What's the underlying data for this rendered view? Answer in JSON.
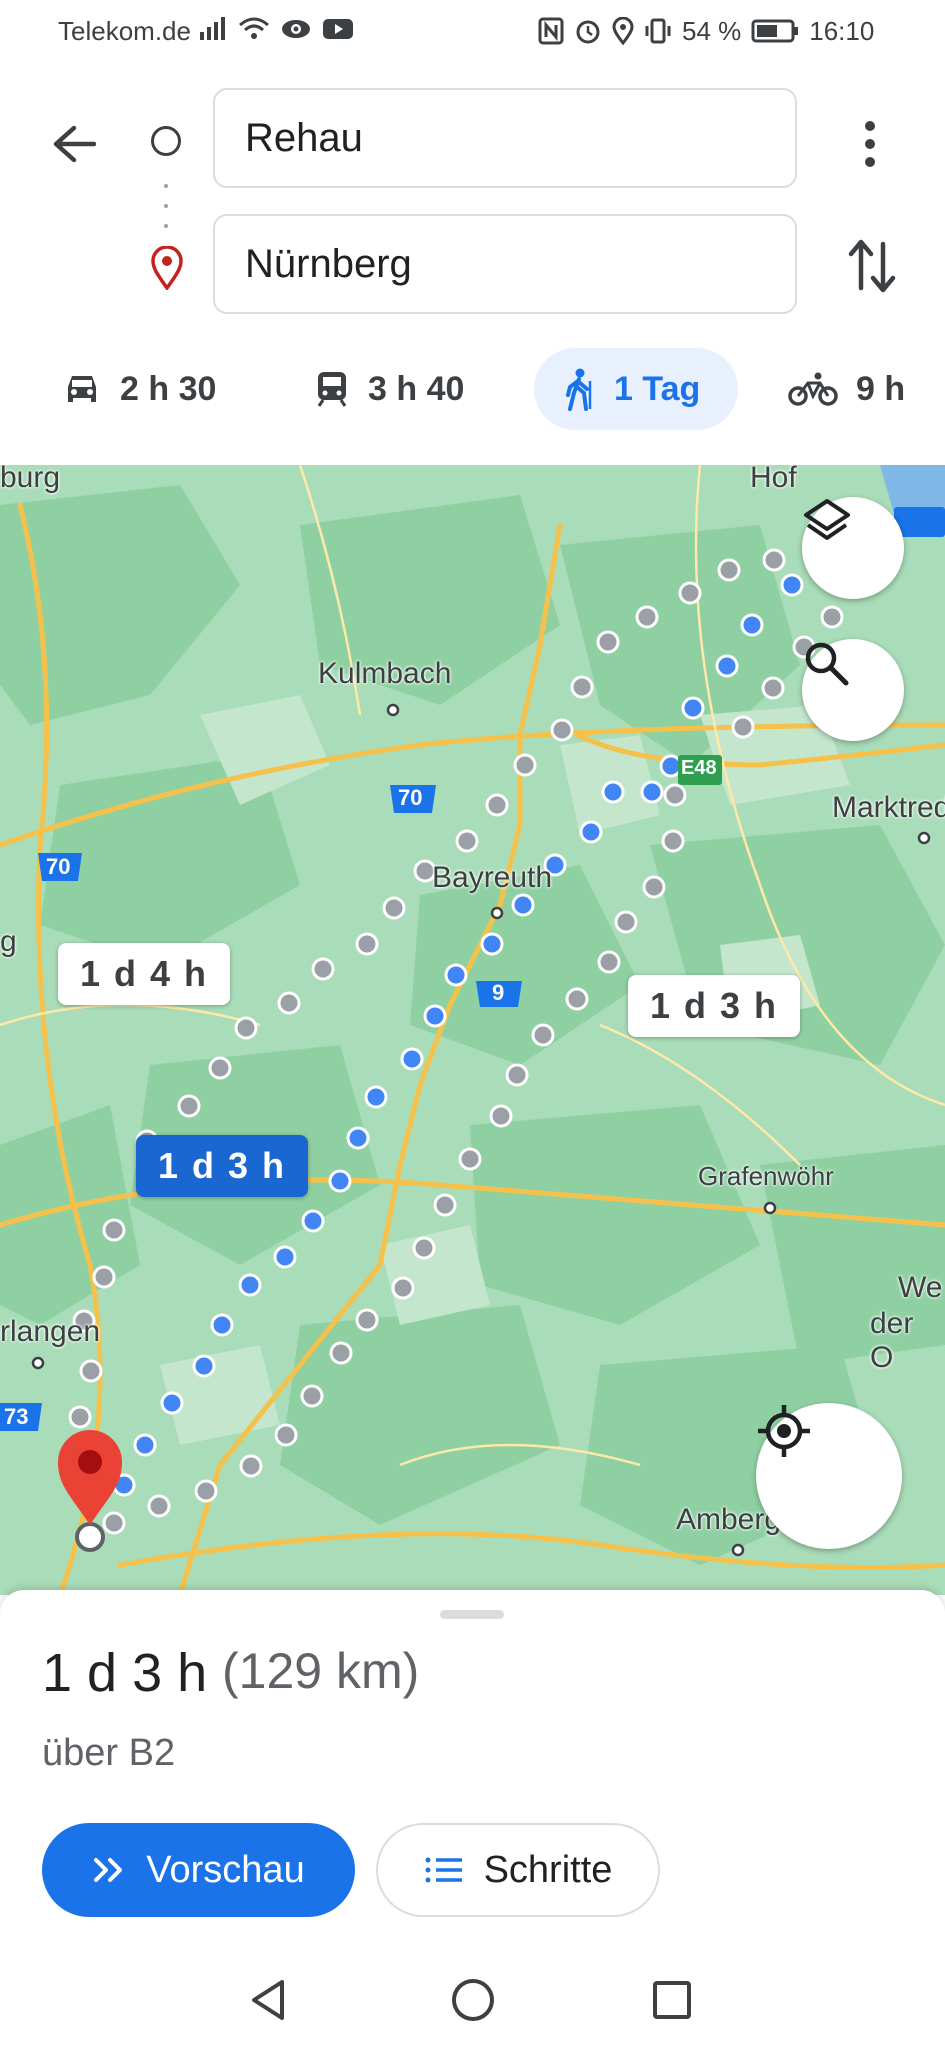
{
  "status_bar": {
    "carrier": "Telekom.de",
    "battery": "54 %",
    "time": "16:10"
  },
  "route_inputs": {
    "origin": "Rehau",
    "destination": "Nürnberg"
  },
  "travel_modes": [
    {
      "icon": "car-icon",
      "label": "2 h 30"
    },
    {
      "icon": "train-icon",
      "label": "3 h 40"
    },
    {
      "icon": "walk-icon",
      "label": "1 Tag"
    },
    {
      "icon": "bike-icon",
      "label": "9 h"
    }
  ],
  "map": {
    "cities": [
      "Hof",
      "Kulmbach",
      "Bayreuth",
      "Marktred",
      "Grafenwöhr",
      "rlangen",
      "Amberg",
      "We",
      "der O",
      "burg",
      "g"
    ],
    "road_shields": [
      "70",
      "70",
      "9",
      "73",
      "E48"
    ],
    "route_labels": [
      "1 d 4 h",
      "1 d 3 h",
      "1 d 3 h"
    ],
    "colors": {
      "route_selected": "#4285f4",
      "route_alt": "#9aa0a6",
      "map_green": "#a9dcb8",
      "pin": "#ea4335"
    }
  },
  "bottom_sheet": {
    "duration": "1 d 3 h",
    "distance": "(129 km)",
    "via": "über B2",
    "preview_label": "Vorschau",
    "steps_label": "Schritte"
  }
}
